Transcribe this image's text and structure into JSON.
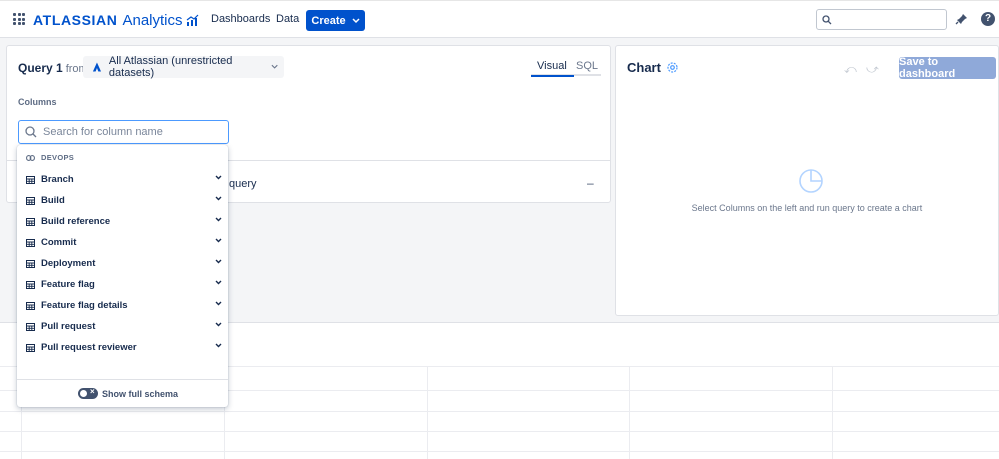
{
  "header": {
    "brand": "ATLASSIAN",
    "product": "Analytics",
    "nav": [
      "Dashboards",
      "Data"
    ],
    "create_label": "Create",
    "search_placeholder": ""
  },
  "query": {
    "title": "Query 1",
    "from_label": "from",
    "dataset": "All Atlassian (unrestricted datasets)",
    "tabs": [
      "Visual",
      "SQL"
    ],
    "columns_label": "Columns",
    "search_placeholder": "Search for column name",
    "run_text": "query",
    "collapse_symbol": "–"
  },
  "dropdown": {
    "group": "DEVOPS",
    "items": [
      "Branch",
      "Build",
      "Build reference",
      "Commit",
      "Deployment",
      "Feature flag",
      "Feature flag details",
      "Pull request",
      "Pull request reviewer"
    ],
    "toggle_label": "Show full schema"
  },
  "chart": {
    "title": "Chart",
    "save_label": "Save to dashboard",
    "empty_text": "Select Columns on the left and run query to create a chart"
  },
  "colors": {
    "primary": "#0052cc",
    "focus": "#4c9aff",
    "disabled_button": "#8fa9d9"
  }
}
